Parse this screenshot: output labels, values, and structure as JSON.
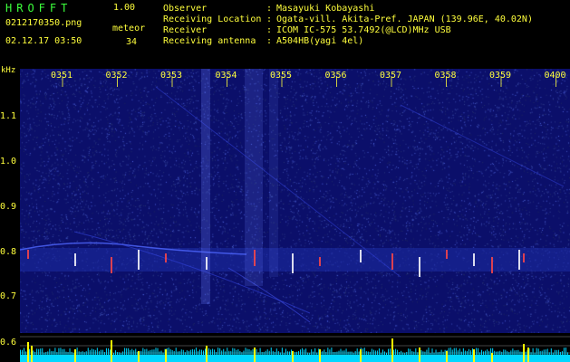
{
  "header": {
    "app_title": "HROFFT",
    "app_version": "1.00",
    "filename": "0212170350.png",
    "datetime": "02.12.17 03:50",
    "meteor_label": "meteor",
    "meteor_count": "34",
    "info": [
      {
        "label": "Observer",
        "value": "Masayuki Kobayashi"
      },
      {
        "label": "Receiving Location",
        "value": "Ogata-vill. Akita-Pref. JAPAN (139.96E, 40.02N)"
      },
      {
        "label": "Receiver",
        "value": "ICOM IC-575 53.7492(@LCD)MHz USB"
      },
      {
        "label": "Receiving antenna",
        "value": "A504HB(yagi 4el)"
      }
    ]
  },
  "spectrogram": {
    "unit_label": "kHz",
    "time_ticks": [
      "0351",
      "0352",
      "0353",
      "0354",
      "0355",
      "0356",
      "0357",
      "0358",
      "0359",
      "0400"
    ],
    "freq_ticks": [
      "1.1",
      "1.0",
      "0.9",
      "0.8",
      "0.7",
      "0.6"
    ],
    "colors": {
      "background": "#0b0f6a",
      "noise": "#5b6bff",
      "echo": "#ff4040",
      "level_bars": "#ffff00",
      "noise_floor": "#00e0ff"
    }
  }
}
